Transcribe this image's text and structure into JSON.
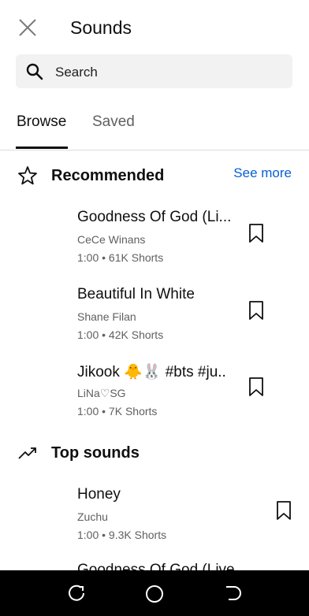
{
  "header": {
    "title": "Sounds",
    "close_icon": "close-icon"
  },
  "search": {
    "placeholder": "Search",
    "value": ""
  },
  "tabs": [
    {
      "label": "Browse",
      "active": true
    },
    {
      "label": "Saved",
      "active": false
    }
  ],
  "recommended": {
    "title": "Recommended",
    "see_more": "See more",
    "icon": "star-outline-icon",
    "items": [
      {
        "title": "Goodness Of God (Li...",
        "artist": "CeCe Winans",
        "meta": "1:00 • 61K Shorts"
      },
      {
        "title": "Beautiful In White",
        "artist": "Shane Filan",
        "meta": "1:00 • 42K Shorts"
      },
      {
        "title": "Jikook 🐥🐰 #bts #ju..",
        "artist": "LiNa♡SG",
        "meta": "1:00 • 7K Shorts"
      }
    ]
  },
  "top_sounds": {
    "title": "Top sounds",
    "icon": "trending-icon",
    "items": [
      {
        "title": "Honey",
        "artist": "Zuchu",
        "meta": "1:00 • 9.3K Shorts"
      },
      {
        "title": "Goodness Of God (Live)",
        "artist": "",
        "meta": ""
      }
    ]
  },
  "colors": {
    "accent": "#065fd4",
    "text": "#0f0f0f",
    "secondary": "#606060",
    "search_bg": "#f2f2f2",
    "navbar": "#000000"
  }
}
